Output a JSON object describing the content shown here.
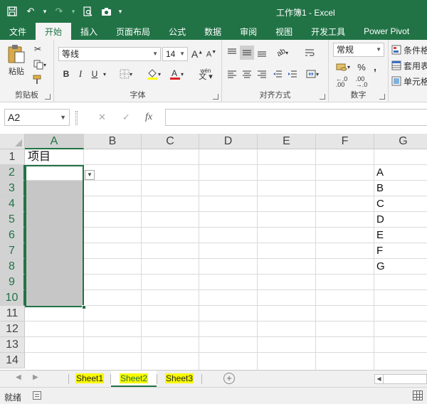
{
  "window": {
    "title": "工作簿1 - Excel"
  },
  "ribbon_tabs": [
    {
      "label": "文件",
      "active": false
    },
    {
      "label": "开始",
      "active": true
    },
    {
      "label": "插入",
      "active": false
    },
    {
      "label": "页面布局",
      "active": false
    },
    {
      "label": "公式",
      "active": false
    },
    {
      "label": "数据",
      "active": false
    },
    {
      "label": "审阅",
      "active": false
    },
    {
      "label": "视图",
      "active": false
    },
    {
      "label": "开发工具",
      "active": false
    },
    {
      "label": "Power Pivot",
      "active": false
    }
  ],
  "ribbon": {
    "clipboard": {
      "label": "剪贴板",
      "paste_label": "粘贴"
    },
    "font": {
      "label": "字体",
      "font_name": "等线",
      "font_size": "14",
      "bold": "B",
      "italic": "I",
      "underline": "U",
      "phonetic": "wén"
    },
    "alignment": {
      "label": "对齐方式"
    },
    "number": {
      "label": "数字",
      "format": "常规",
      "percent": "%",
      "comma": ","
    },
    "styles": {
      "conditional": "条件格",
      "table": "套用表",
      "cell": "单元格"
    }
  },
  "formula_bar": {
    "name_box": "A2",
    "fx": "fx",
    "content": ""
  },
  "sheet": {
    "columns": [
      "A",
      "B",
      "C",
      "D",
      "E",
      "F",
      "G"
    ],
    "rows": [
      "1",
      "2",
      "3",
      "4",
      "5",
      "6",
      "7",
      "8",
      "9",
      "10",
      "11",
      "12",
      "13",
      "14"
    ],
    "selected_column": "A",
    "cells": {
      "A1": "项目",
      "G2": "A",
      "G3": "B",
      "G4": "C",
      "G5": "D",
      "G6": "E",
      "G7": "F",
      "G8": "G"
    }
  },
  "sheet_tabs": [
    {
      "label": "Sheet1",
      "active": false
    },
    {
      "label": "Sheet2",
      "active": true
    },
    {
      "label": "Sheet3",
      "active": false
    }
  ],
  "status": {
    "text": "就绪"
  },
  "colors": {
    "brand": "#217346",
    "highlight": "#f9f900",
    "selection_fill": "#c6c6c6"
  }
}
